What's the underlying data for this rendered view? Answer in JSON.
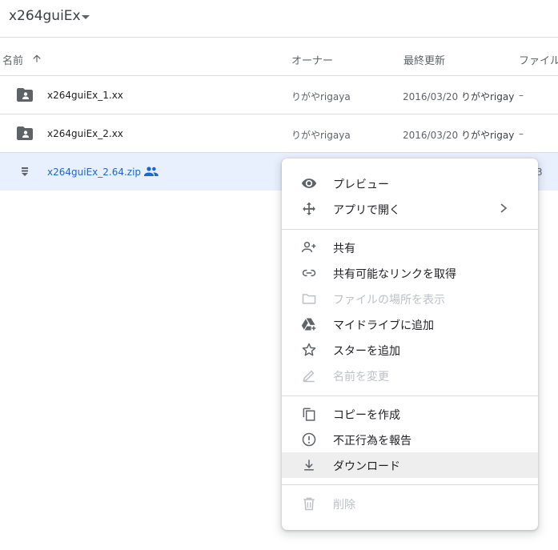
{
  "header": {
    "title": "x264guiEx"
  },
  "columns": {
    "name": "名前",
    "owner": "オーナー",
    "modified": "最終更新",
    "size": "ファイル"
  },
  "rows": [
    {
      "name": "x264guiEx_1.xx",
      "owner": "りがやrigaya",
      "modified": "2016/03/20",
      "modified_by": "りがやrigaya",
      "size": "–"
    },
    {
      "name": "x264guiEx_2.xx",
      "owner": "りがやrigaya",
      "modified": "2016/03/20",
      "modified_by": "りがやrigaya",
      "size": "–"
    },
    {
      "name": "x264guiEx_2.64.zip",
      "size_partial": "3"
    }
  ],
  "menu": {
    "preview": "プレビュー",
    "open_with": "アプリで開く",
    "share": "共有",
    "get_link": "共有可能なリンクを取得",
    "show_location": "ファイルの場所を表示",
    "add_to_drive": "マイドライブに追加",
    "add_star": "スターを追加",
    "rename": "名前を変更",
    "make_copy": "コピーを作成",
    "report_abuse": "不正行為を報告",
    "download": "ダウンロード",
    "remove": "削除"
  },
  "colors": {
    "accent": "#1967d2",
    "selected_row": "#e8f0fe",
    "disabled": "#bdc1c6",
    "icon": "#5f6368"
  }
}
